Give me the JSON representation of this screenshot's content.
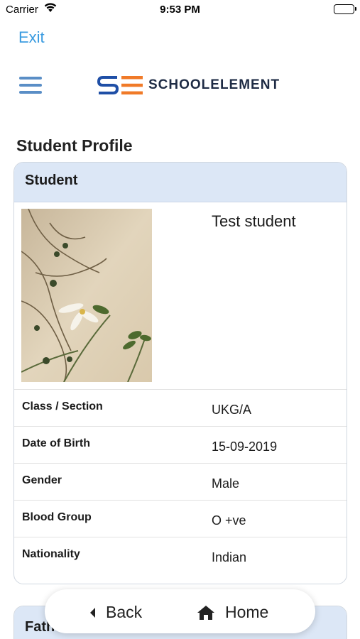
{
  "status_bar": {
    "carrier": "Carrier",
    "time": "9:53 PM"
  },
  "exit_label": "Exit",
  "logo": {
    "mark": "SE",
    "text": "SCHOOLELEMENT",
    "colors": {
      "blue": "#1f4fa6",
      "orange": "#f07a28"
    }
  },
  "page_title": "Student Profile",
  "student_card": {
    "header": "Student",
    "name": "Test student",
    "fields": [
      {
        "label": "Class / Section",
        "value": "UKG/A"
      },
      {
        "label": "Date of Birth",
        "value": "15-09-2019"
      },
      {
        "label": "Gender",
        "value": "Male"
      },
      {
        "label": "Blood Group",
        "value": "O +ve"
      },
      {
        "label": "Nationality",
        "value": "Indian"
      }
    ]
  },
  "next_card": {
    "header": "Fath"
  },
  "bottom_nav": {
    "back_label": "Back",
    "home_label": "Home"
  },
  "colors": {
    "accent": "#3a9be0",
    "header_bg": "#dce7f6"
  }
}
